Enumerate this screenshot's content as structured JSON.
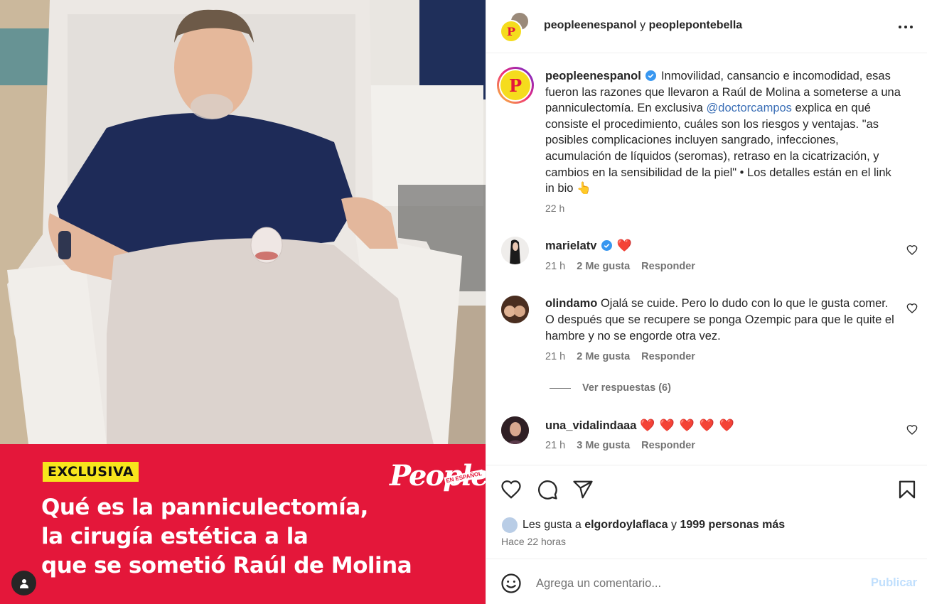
{
  "post": {
    "image": {
      "tag": "EXCLUSIVA",
      "logo": "People",
      "logo_sub": "EN ESPAÑOL",
      "headline_lines": [
        "Qué es la panniculectomía,",
        " la cirugía estética a la",
        "que se sometió Raúl de Molina"
      ]
    },
    "header": {
      "owner": "peopleenespanol",
      "joiner": "y",
      "collaborator": "peoplepontebella"
    },
    "caption": {
      "username": "peopleenespanol",
      "text_before_mention": "Inmovilidad, cansancio e incomodidad, esas fueron las razones que llevaron a Raúl de Molina a someterse a una panniculectomía. En exclusiva ",
      "mention": "@doctorcampos",
      "text_after_mention": " explica en qué consiste el procedimiento, cuáles son los riesgos y ventajas. \"as posibles complicaciones incluyen sangrado, infecciones, acumulación de líquidos (seromas), retraso en la cicatrización, y cambios en la sensibilidad de la piel\" • Los detalles están en el link in bio 👆",
      "time": "22 h"
    },
    "comments": [
      {
        "username": "marielatv",
        "verified": true,
        "text": "❤️",
        "time": "21 h",
        "likes": "2 Me gusta",
        "reply": "Responder"
      },
      {
        "username": "olindamo",
        "verified": false,
        "text": "Ojalá se cuide. Pero lo dudo con lo que le gusta comer. O después que se recupere se ponga Ozempic para que le quite el hambre y no se engorde otra vez.",
        "time": "21 h",
        "likes": "2 Me gusta",
        "reply": "Responder",
        "view_replies": "Ver respuestas (6)"
      },
      {
        "username": "una_vidalindaaa",
        "verified": false,
        "text": "❤️ ❤️ ❤️ ❤️ ❤️",
        "time": "21 h",
        "likes": "3 Me gusta",
        "reply": "Responder"
      }
    ],
    "likes": {
      "prefix": "Les gusta a",
      "user": "elgordoylaflaca",
      "joiner": "y",
      "others": "1999 personas más"
    },
    "posted_ago": "Hace 22 horas",
    "add_comment": {
      "placeholder": "Agrega un comentario...",
      "publish_label": "Publicar"
    }
  },
  "colors": {
    "brand_red": "#e4173a",
    "tag_yellow": "#f7e51c",
    "link_blue": "#3b6fb6",
    "heart": "#ed1c4f",
    "publish_disabled": "#c0dffd"
  },
  "icons": [
    "more-icon",
    "verified-icon",
    "heart-icon",
    "comment-icon",
    "share-icon",
    "bookmark-icon",
    "emoji-icon",
    "user-icon"
  ]
}
